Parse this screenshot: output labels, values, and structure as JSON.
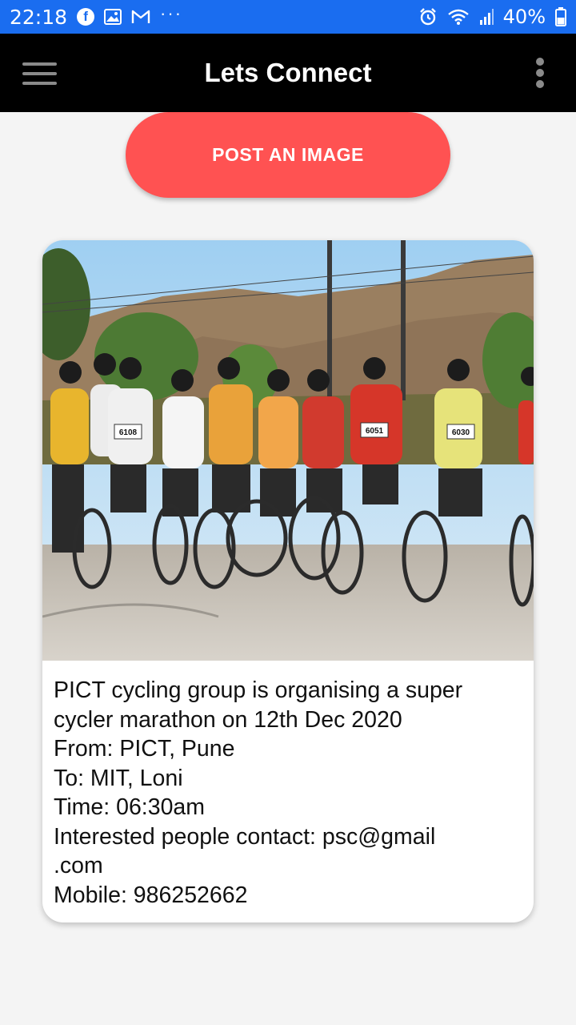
{
  "status_bar": {
    "time": "22:18",
    "dots": "···",
    "battery": "40%",
    "color": "#1a6df0"
  },
  "app_bar": {
    "title": "Lets Connect"
  },
  "post_button": {
    "label": "POST AN IMAGE",
    "color": "#ff5252"
  },
  "post": {
    "lines": [
      "PICT cycling group is organising a super",
      "cycler marathon on 12th Dec 2020",
      "From: PICT, Pune",
      "To: MIT, Loni",
      "Time: 06:30am",
      "Interested people contact: psc@gmail",
      ".com",
      "Mobile: 986252662"
    ],
    "bib_numbers": [
      "6108",
      "6051",
      "6030"
    ]
  }
}
